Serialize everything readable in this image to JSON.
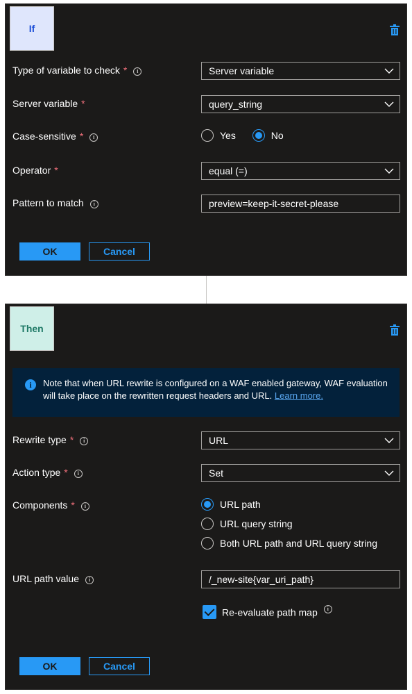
{
  "if_panel": {
    "chip": "If",
    "fields": {
      "variable_type": {
        "label": "Type of variable to check",
        "value": "Server variable"
      },
      "server_variable": {
        "label": "Server variable",
        "value": "query_string"
      },
      "case_sensitive": {
        "label": "Case-sensitive",
        "options": [
          "Yes",
          "No"
        ],
        "selected": "No"
      },
      "operator": {
        "label": "Operator",
        "value": "equal (=)"
      },
      "pattern": {
        "label": "Pattern to match",
        "value": "preview=keep-it-secret-please"
      }
    },
    "ok_label": "OK",
    "cancel_label": "Cancel"
  },
  "then_panel": {
    "chip": "Then",
    "notice": {
      "text": "Note that when URL rewrite is configured on a WAF enabled gateway, WAF evaluation will take place on the rewritten request headers and URL.",
      "link": "Learn more."
    },
    "fields": {
      "rewrite_type": {
        "label": "Rewrite type",
        "value": "URL"
      },
      "action_type": {
        "label": "Action type",
        "value": "Set"
      },
      "components": {
        "label": "Components",
        "options": [
          "URL path",
          "URL query string",
          "Both URL path and URL query string"
        ],
        "selected": "URL path"
      },
      "url_path_value": {
        "label": "URL path value",
        "value": "/_new-site{var_uri_path}"
      },
      "reevaluate": {
        "label": "Re-evaluate path map",
        "checked": true
      }
    },
    "ok_label": "OK",
    "cancel_label": "Cancel"
  },
  "colors": {
    "accent": "#2899f5",
    "required": "#f1707b",
    "panel": "#1b1a19"
  }
}
